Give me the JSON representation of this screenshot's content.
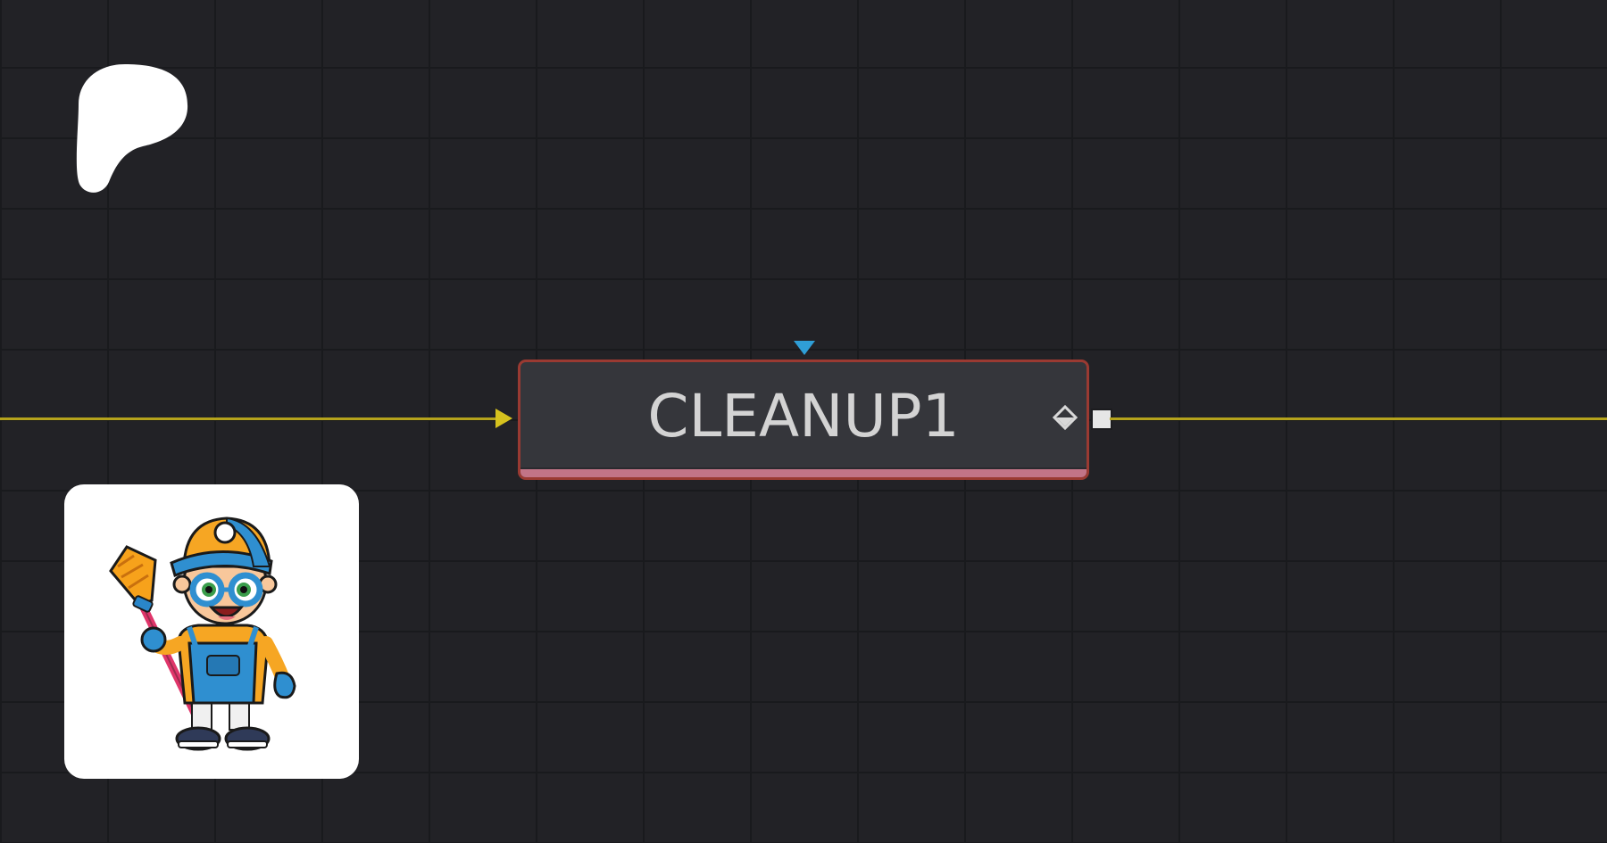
{
  "node": {
    "label": "CLEANUP1",
    "border_color": "#9a3a32",
    "strip_color": "#c27487"
  },
  "connections": {
    "wire_color": "#b5a31c",
    "mask_input_color": "#2f9ed6"
  },
  "icons": {
    "brand": "patreon-logo-icon",
    "avatar": "cleaner-mascot-avatar",
    "keyframe": "keyframe-diamond-icon",
    "output": "output-port-square"
  }
}
